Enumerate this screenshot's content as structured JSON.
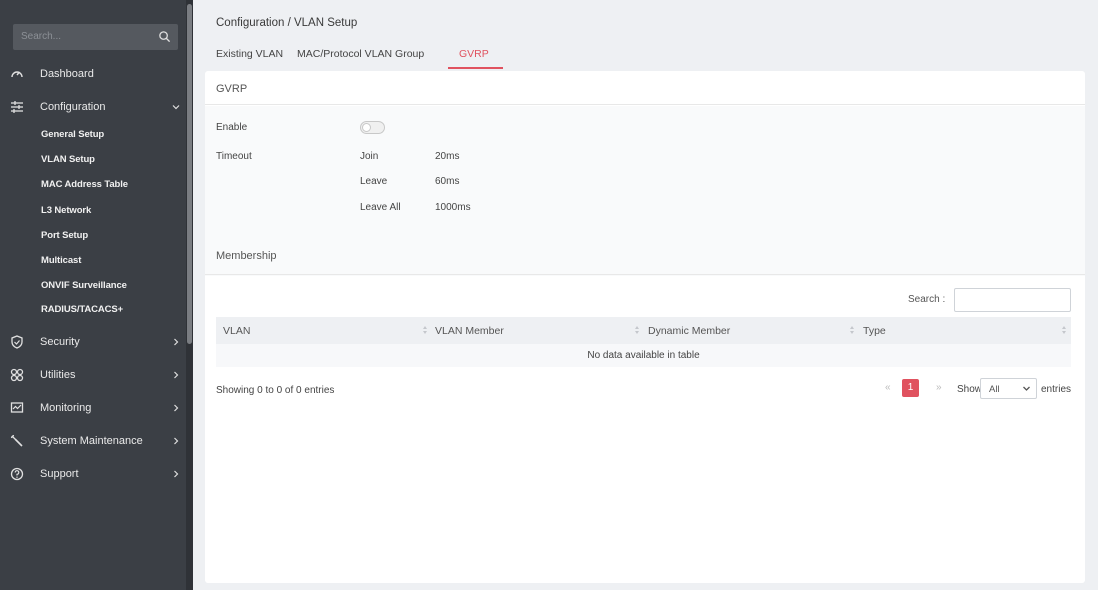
{
  "sidebar": {
    "search_placeholder": "Search...",
    "items": [
      {
        "label": "Dashboard"
      },
      {
        "label": "Configuration"
      },
      {
        "label": "Security"
      },
      {
        "label": "Utilities"
      },
      {
        "label": "Monitoring"
      },
      {
        "label": "System Maintenance"
      },
      {
        "label": "Support"
      }
    ],
    "config_sub": [
      "General Setup",
      "VLAN Setup",
      "MAC Address Table",
      "L3 Network",
      "Port Setup",
      "Multicast",
      "ONVIF Surveillance",
      "RADIUS/TACACS+"
    ]
  },
  "breadcrumb": "Configuration / VLAN Setup",
  "tabs": [
    "Existing VLAN",
    "MAC/Protocol VLAN Group",
    "GVRP"
  ],
  "active_tab": "GVRP",
  "gvrp": {
    "title": "GVRP",
    "enable_label": "Enable",
    "enabled": false,
    "timeout_label": "Timeout",
    "rows": [
      {
        "name": "Join",
        "value": "20ms"
      },
      {
        "name": "Leave",
        "value": "60ms"
      },
      {
        "name": "Leave All",
        "value": "1000ms"
      }
    ]
  },
  "membership": {
    "title": "Membership",
    "search_label": "Search :",
    "columns": [
      "VLAN",
      "VLAN Member",
      "Dynamic Member",
      "Type"
    ],
    "empty_text": "No data available in table",
    "info": "Showing 0 to 0 of 0 entries",
    "pagination": {
      "prev": "«",
      "current": "1",
      "next": "»"
    },
    "show_label": "Show",
    "show_value": "All",
    "entries_label": "entries"
  },
  "colors": {
    "accent": "#e0525f",
    "sidebar_bg": "#3b3f45",
    "page_bg": "#eef0f3"
  }
}
